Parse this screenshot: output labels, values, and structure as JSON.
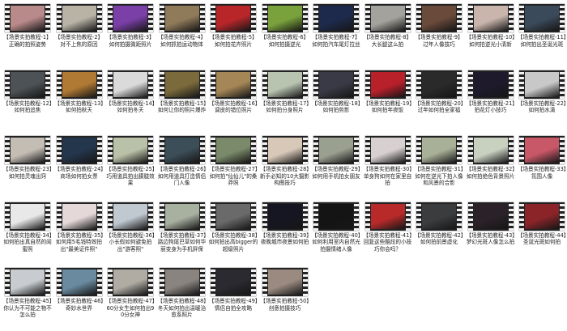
{
  "items": [
    {
      "title": "【场景实拍教程-1】正确的拍照姿势",
      "color": "#b98a8a"
    },
    {
      "title": "【场景实拍教程-2】对不上焦的原因",
      "color": "#b9b3a6"
    },
    {
      "title": "【场景实拍教程-3】如何拍摄微距照片",
      "color": "#7b3fa8"
    },
    {
      "title": "【场景实拍教程-4】如何抓拍运动物体",
      "color": "#8f7a5a"
    },
    {
      "title": "【场景实拍教程-5】如何拍花卉照片",
      "color": "#b8262a"
    },
    {
      "title": "【场景实拍教程-6】如何拍摄逆光",
      "color": "#7aa23c"
    },
    {
      "title": "【场景实拍教程-7】如何拍汽车尾灯拉丝",
      "color": "#1d2a4c"
    },
    {
      "title": "【场景实拍教程-8】大长腿这么拍",
      "color": "#a3a29c"
    },
    {
      "title": "【场景实拍教程-9】过年人像技巧",
      "color": "#6a4a3a"
    },
    {
      "title": "【场景实拍教程-10】如何拍逆光小清新",
      "color": "#c9b5ac"
    },
    {
      "title": "【场景实拍教程-11】如何拍出圣诞光斑",
      "color": "#3b4a5a"
    },
    {
      "title": "【场景实拍教程-12】如何拍追焦",
      "color": "#4c5256"
    },
    {
      "title": "【场景实拍教程-13】如何拍秋天",
      "color": "#b07a34"
    },
    {
      "title": "【场景实拍教程-14】如何拍冬天",
      "color": "#dadada"
    },
    {
      "title": "【场景实拍教程-15】如何让你的照片爆炸",
      "color": "#7a6a3c"
    },
    {
      "title": "【场景实拍教程-16】调皮的错位照片",
      "color": "#a58656"
    },
    {
      "title": "【场景实拍教程-17】如何拍分身照片",
      "color": "#b8c4b0"
    },
    {
      "title": "【场景实拍教程-18】如何拍剪影",
      "color": "#3a3a46"
    },
    {
      "title": "【场景实拍教程-19】如何拍年夜饭",
      "color": "#b8202a"
    },
    {
      "title": "【场景实拍教程-20】过年如何拍全家福",
      "color": "#2a2a2a"
    },
    {
      "title": "【场景实拍教程-21】拍花灯小技巧",
      "color": "#1e1a2c"
    },
    {
      "title": "【场景实拍教程-22】如何拍水滴",
      "color": "#c8c8c8"
    },
    {
      "title": "【场景实拍教程-23】如何拍灵魂出窍",
      "color": "#c4bdb4"
    },
    {
      "title": "【场景实拍教程-24】商场如何拍女票",
      "color": "#24364c"
    },
    {
      "title": "【场景实拍教程-25】巧用道具拍出朦胧效果",
      "color": "#b9c2a8"
    },
    {
      "title": "【场景实拍教程-26】如何用道具打造情侣门人像",
      "color": "#3c4e58"
    },
    {
      "title": "【场景实拍教程-27】如何拍\"仙仙儿\"的桑莽照",
      "color": "#7a8a6a"
    },
    {
      "title": "【场景实拍教程-28】新手必知的10大摄影构图技巧",
      "color": "#d8c8b8"
    },
    {
      "title": "【场景实拍教程-29】如何用手机拍女朋友",
      "color": "#9aa090"
    },
    {
      "title": "【场景实拍教程-30】单身狗如何在家里自拍",
      "color": "#d8d0d0"
    },
    {
      "title": "【场景实拍教程-31】如何在逆光下拍人像和风景的合影",
      "color": "#a8b098"
    },
    {
      "title": "【场景实拍教程-32】如何拍绝色背景照片",
      "color": "#c8d0c0"
    },
    {
      "title": "【场景实拍教程-33】氛围人像",
      "color": "#c85868"
    },
    {
      "title": "【场景实拍教程-34】如何拍出真自然的闺蜜照",
      "color": "#e8e8e8"
    },
    {
      "title": "【场景实拍教程-35】如何用5毛钱特效拍出\"最美证件照\"",
      "color": "#e4d8d8"
    },
    {
      "title": "【场景实拍教程-36】小长假如何避免拍出\"游客照\"",
      "color": "#c0c8d0"
    },
    {
      "title": "【场景实拍教程-37】路边狗尾巴草如何华丽变身为手机屏保",
      "color": "#a8b0a0"
    },
    {
      "title": "【场景实拍教程-38】如何拍出高bigger的超级照片",
      "color": "#6a6a6a"
    },
    {
      "title": "【场景实拍教程-39】夜晚城市夜景如何拍",
      "color": "#161622"
    },
    {
      "title": "【场景实拍教程-40】如何利用室内自然光拍摄情绪人像",
      "color": "#141414"
    },
    {
      "title": "【场景实拍教程-41】回复这些酷炫的小技巧你会吗？",
      "color": "#b82a2a"
    },
    {
      "title": "【场景实拍教程-42】如何拍前景虚化",
      "color": "#3a3c3e"
    },
    {
      "title": "【场景实拍教程-43】梦幻光斑人像怎么拍",
      "color": "#2a2228"
    },
    {
      "title": "【场景实拍教程-44】圣诞光斑如何拍",
      "color": "#8a2428"
    },
    {
      "title": "【场景实拍教程-45】你认为不可能之物不怎么拍",
      "color": "#c8ccd0"
    },
    {
      "title": "【场景实拍教程-46】奇妙水世界",
      "color": "#6a8aa0"
    },
    {
      "title": "【场景实拍教程-47】60分女生如何拍出90分女神",
      "color": "#b0aca4"
    },
    {
      "title": "【场景实拍教程-48】冬天如何拍出温暖治愈系照片",
      "color": "#8a8480"
    },
    {
      "title": "【场景实拍教程-49】情侣自拍全攻略",
      "color": "#2a2a30"
    },
    {
      "title": "【场景实拍教程-50】创意拍摄技巧",
      "color": "#9a8a80"
    }
  ]
}
